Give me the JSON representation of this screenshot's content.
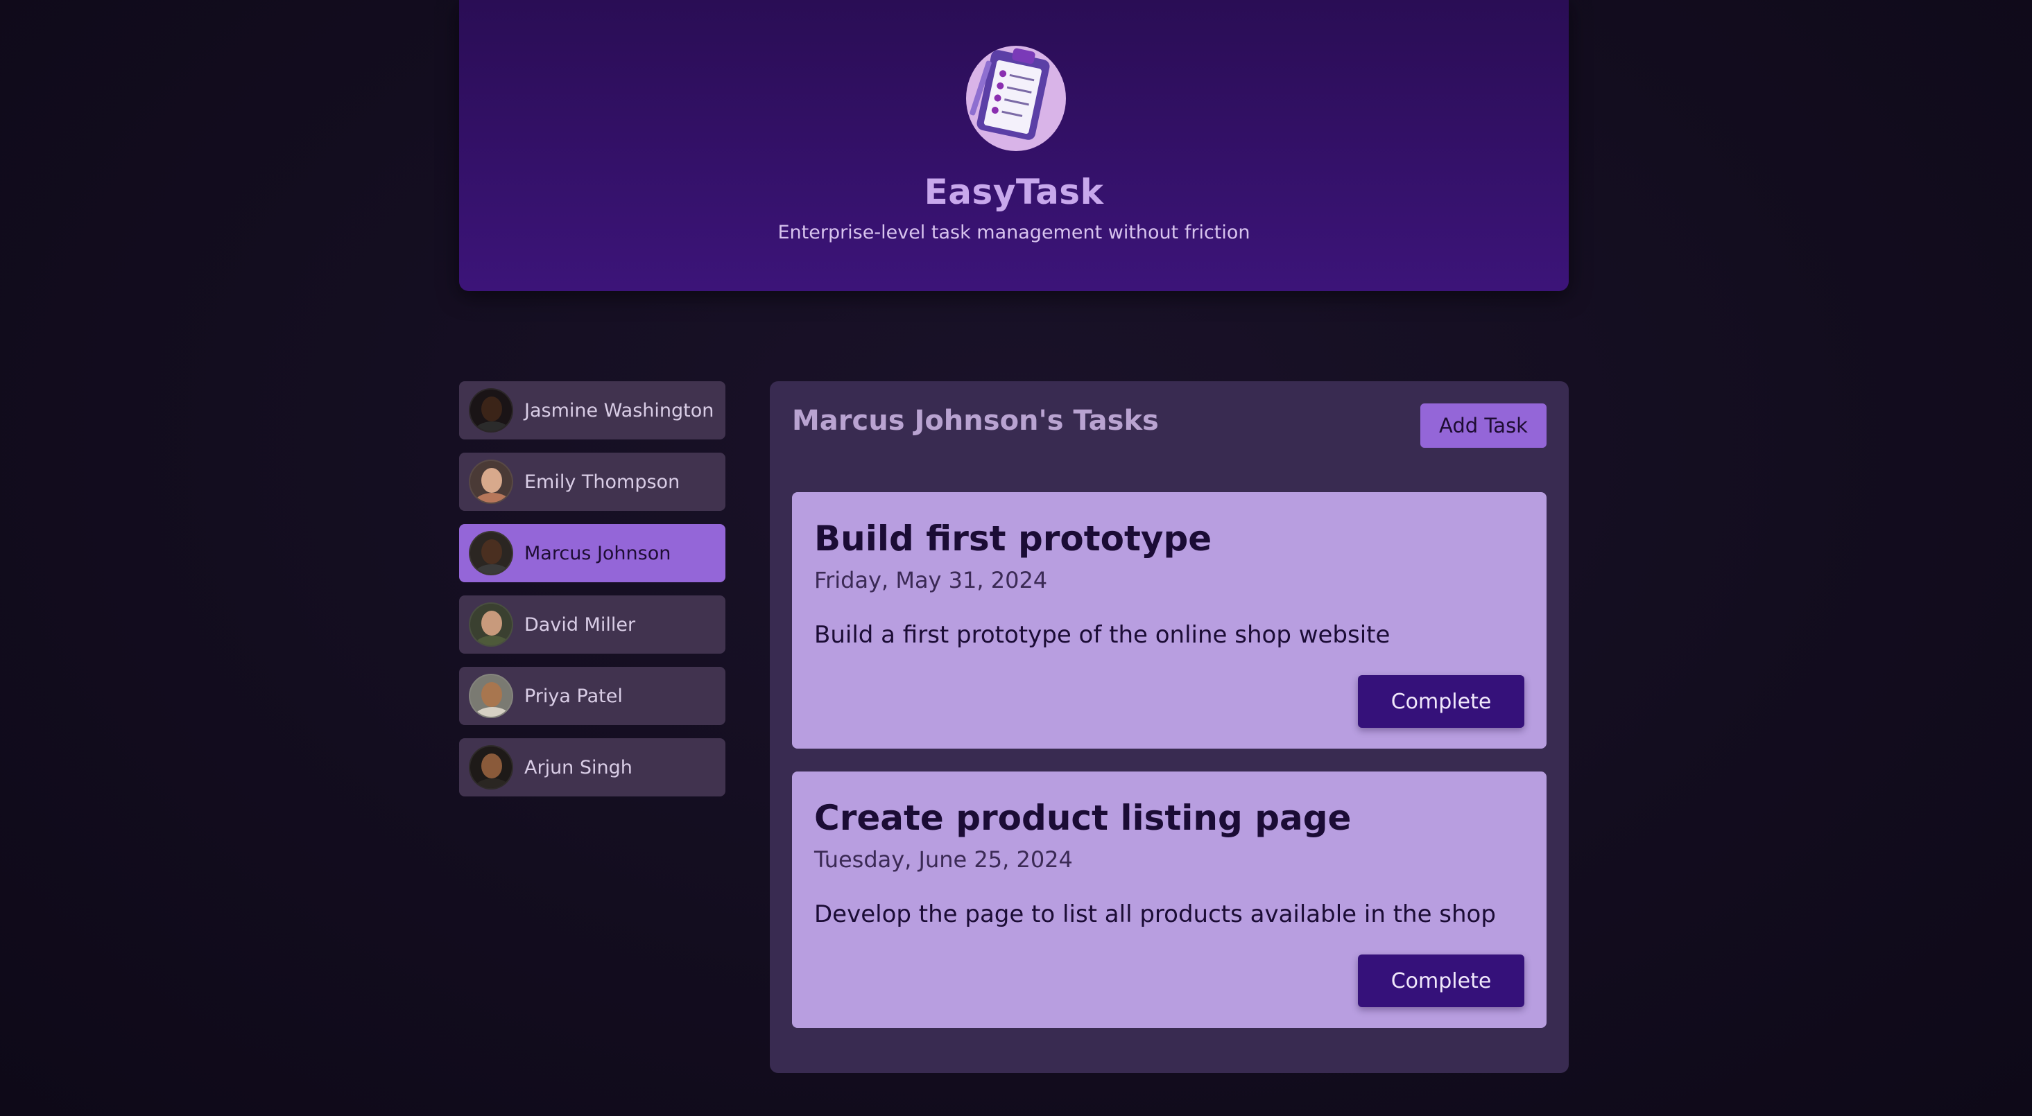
{
  "header": {
    "logo_icon": "clipboard-checklist-icon",
    "title": "EasyTask",
    "subtitle": "Enterprise-level task management without friction"
  },
  "users": [
    {
      "name": "Jasmine Washington",
      "selected": false
    },
    {
      "name": "Emily Thompson",
      "selected": false
    },
    {
      "name": "Marcus Johnson",
      "selected": true
    },
    {
      "name": "David Miller",
      "selected": false
    },
    {
      "name": "Priya Patel",
      "selected": false
    },
    {
      "name": "Arjun Singh",
      "selected": false
    }
  ],
  "tasks_panel": {
    "title": "Marcus Johnson's Tasks",
    "add_label": "Add Task",
    "tasks": [
      {
        "title": "Build first prototype",
        "date": "Friday, May 31, 2024",
        "description": "Build a first prototype of the online shop website",
        "button_label": "Complete"
      },
      {
        "title": "Create product listing page",
        "date": "Tuesday, June 25, 2024",
        "description": "Develop the page to list all products available in the shop",
        "button_label": "Complete"
      }
    ]
  },
  "colors": {
    "background": "#130d1f",
    "header": "#3c1479",
    "accent": "#9466d8",
    "card": "#b89ee0",
    "button": "#35117a"
  }
}
